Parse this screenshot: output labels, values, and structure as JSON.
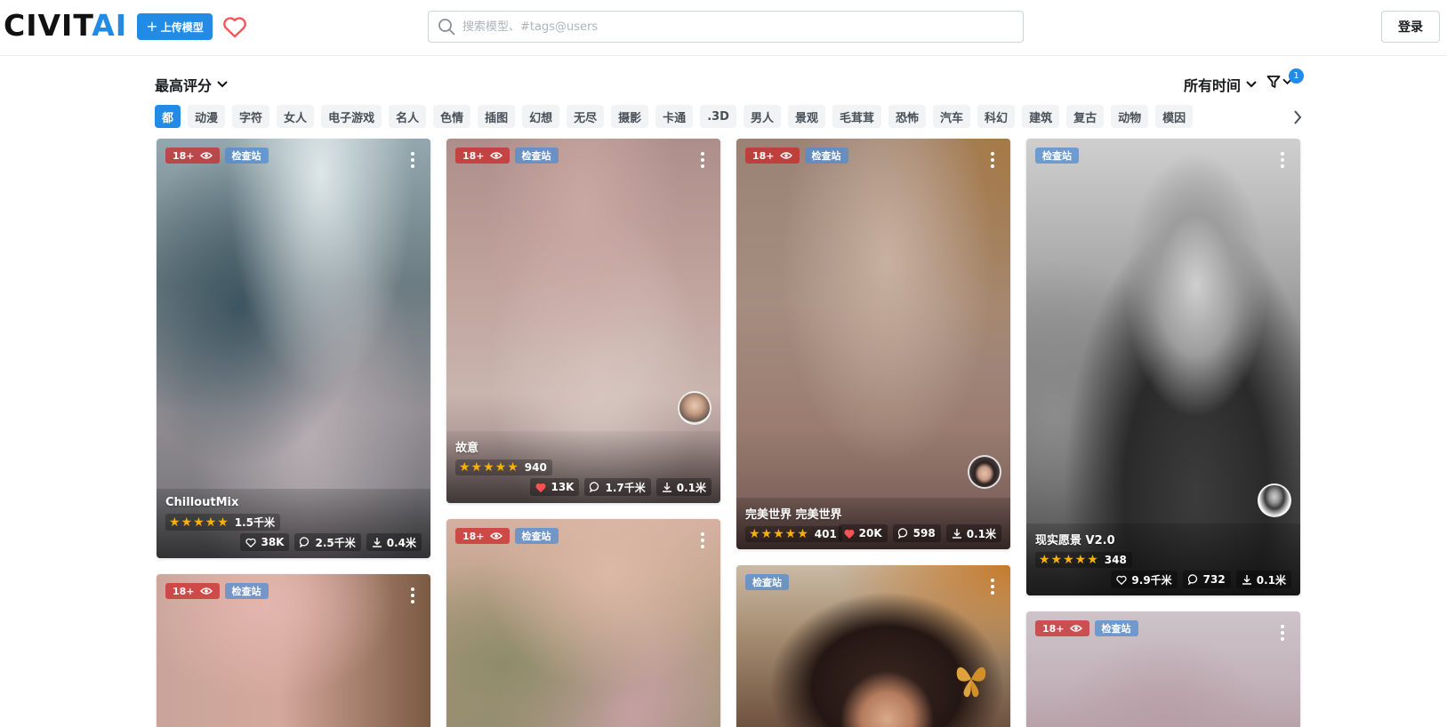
{
  "header": {
    "logo_left": "CIVIT",
    "logo_right": "AI",
    "upload_label": "上传模型",
    "search_placeholder": "搜索模型、#tags@users",
    "login_label": "登录"
  },
  "controls": {
    "sort_label": "最高评分",
    "period_label": "所有时间",
    "filter_count": "1"
  },
  "tags": [
    "都",
    "动漫",
    "字符",
    "女人",
    "电子游戏",
    "名人",
    "色情",
    "插图",
    "幻想",
    "无尽",
    "摄影",
    "卡通",
    ".3D",
    "男人",
    "景观",
    "毛茸茸",
    "恐怖",
    "汽车",
    "科幻",
    "建筑",
    "复古",
    "动物",
    "模因"
  ],
  "badges": {
    "nsfw": "18+",
    "check": "检查站"
  },
  "cards": [
    {
      "name": "ChilloutMix",
      "stars": "★★★★★",
      "rating_count": "1.5千米",
      "likes": "38K",
      "comments": "2.5千米",
      "downloads": "0.4米"
    },
    {
      "name": "故意",
      "stars": "★★★★★",
      "rating_count": "940",
      "likes": "13K",
      "comments": "1.7千米",
      "downloads": "0.1米"
    },
    {
      "name": "完美世界 完美世界",
      "stars": "★★★★★",
      "rating_count": "401",
      "likes": "20K",
      "comments": "598",
      "downloads": "0.1米"
    },
    {
      "name": "现实愿景 V2.0",
      "stars": "★★★★★",
      "rating_count": "348",
      "likes": "9.9千米",
      "comments": "732",
      "downloads": "0.1米"
    }
  ],
  "colors": {
    "accent": "#228be6",
    "star": "#fab005",
    "heart": "#fa5252"
  }
}
